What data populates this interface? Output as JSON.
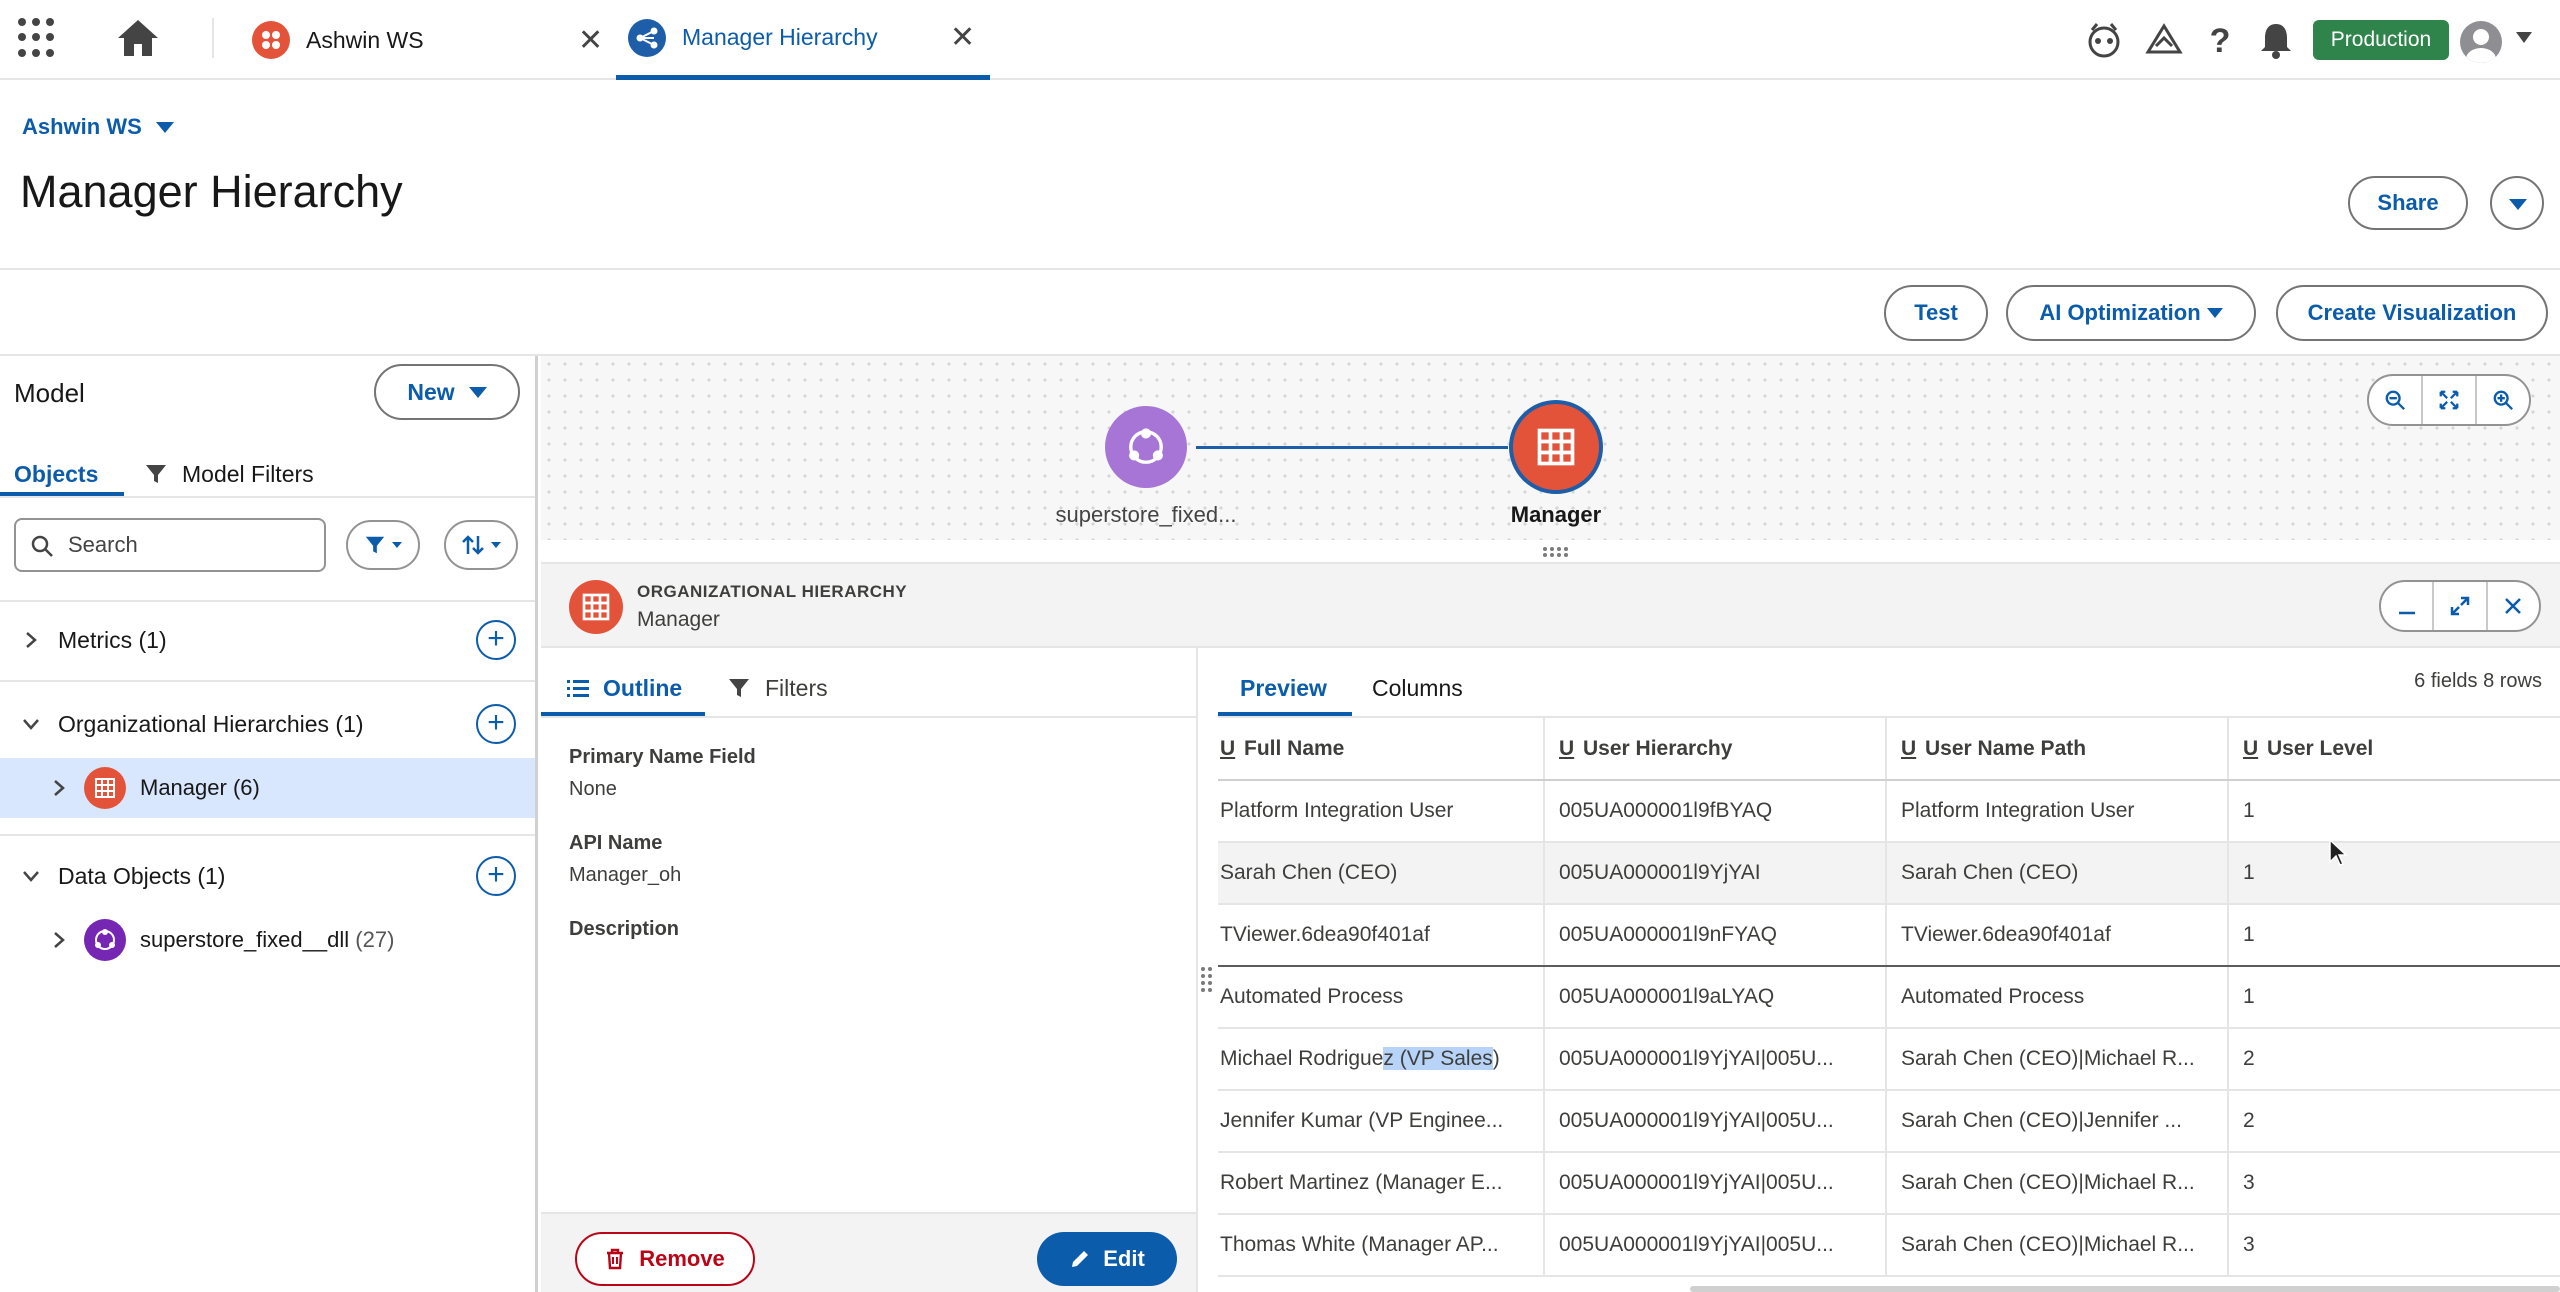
{
  "colors": {
    "brand_blue": "#0b5cab",
    "production_green": "#2e844a",
    "hierarchy_icon": "#e3533a",
    "data_object_icon": "#9b6cd1",
    "remove_red": "#ba0517"
  },
  "topbar": {
    "tabs": [
      {
        "label": "Ashwin WS",
        "icon": "workspace-icon",
        "active": false
      },
      {
        "label": "Manager Hierarchy",
        "icon": "hierarchy-icon",
        "active": true
      }
    ],
    "env_badge": "Production",
    "icons": [
      "app-launcher-icon",
      "home-icon",
      "astro-icon",
      "trailhead-icon",
      "help-icon",
      "bell-icon",
      "avatar-icon"
    ]
  },
  "header": {
    "workspace_link": "Ashwin WS",
    "title": "Manager Hierarchy",
    "share_label": "Share"
  },
  "toolbar": {
    "test_label": "Test",
    "ai_label": "AI Optimization",
    "create_viz_label": "Create Visualization"
  },
  "model": {
    "title": "Model",
    "new_label": "New",
    "tabs": {
      "objects": "Objects",
      "model_filters": "Model Filters"
    },
    "search_placeholder": "Search",
    "sections": [
      {
        "label": "Metrics (1)",
        "expanded": false
      },
      {
        "label": "Organizational Hierarchies (1)",
        "expanded": true,
        "items": [
          {
            "label": "Manager",
            "count": "(6)",
            "selected": true
          }
        ]
      },
      {
        "label": "Data Objects (1)",
        "expanded": true,
        "items": [
          {
            "label": "superstore_fixed__dll",
            "count": "(27)",
            "selected": false
          }
        ]
      }
    ]
  },
  "canvas": {
    "nodes": [
      {
        "label": "superstore_fixed...",
        "type": "data-object"
      },
      {
        "label": "Manager",
        "type": "hierarchy"
      }
    ]
  },
  "detail": {
    "kicker": "ORGANIZATIONAL HIERARCHY",
    "name": "Manager",
    "outline": {
      "tabs": {
        "outline": "Outline",
        "filters": "Filters"
      },
      "fields": [
        {
          "label": "Primary Name Field",
          "value": "None"
        },
        {
          "label": "API Name",
          "value": "Manager_oh"
        },
        {
          "label": "Description",
          "value": ""
        }
      ],
      "remove_label": "Remove",
      "edit_label": "Edit"
    },
    "preview": {
      "tabs": {
        "preview": "Preview",
        "columns": "Columns"
      },
      "stats": "6 fields 8 rows",
      "columns": [
        "Full Name",
        "User Hierarchy",
        "User Name Path",
        "User Level"
      ],
      "rows": [
        [
          "Platform Integration User",
          "005UA000001l9fBYAQ",
          "Platform Integration User",
          "1"
        ],
        [
          "Sarah Chen (CEO)",
          "005UA000001l9YjYAI",
          "Sarah Chen (CEO)",
          "1"
        ],
        [
          "TViewer.6dea90f401af",
          "005UA000001l9nFYAQ",
          "TViewer.6dea90f401af",
          "1"
        ],
        [
          "Automated Process",
          "005UA000001l9aLYAQ",
          "Automated Process",
          "1"
        ],
        [
          "Michael Rodriguez (VP Sales)",
          "005UA000001l9YjYAI|005U...",
          "Sarah Chen (CEO)|Michael R...",
          "2"
        ],
        [
          "Jennifer Kumar (VP Enginee...",
          "005UA000001l9YjYAI|005U...",
          "Sarah Chen (CEO)|Jennifer ...",
          "2"
        ],
        [
          "Robert Martinez (Manager E...",
          "005UA000001l9YjYAI|005U...",
          "Sarah Chen (CEO)|Michael R...",
          "3"
        ],
        [
          "Thomas White (Manager AP...",
          "005UA000001l9YjYAI|005U...",
          "Sarah Chen (CEO)|Michael R...",
          "3"
        ]
      ],
      "highlight_prefix": "Michael Rodrigue",
      "highlight_mid": "z (VP Sales",
      "highlight_suffix": ")"
    }
  }
}
